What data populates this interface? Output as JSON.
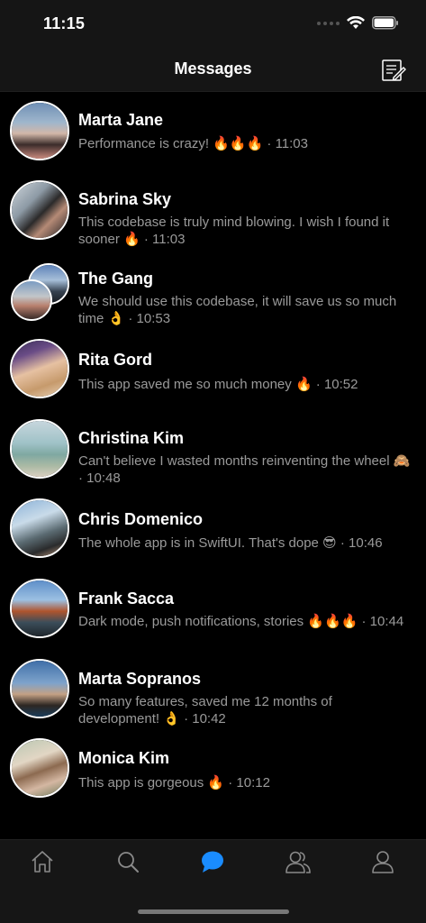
{
  "status": {
    "time": "11:15"
  },
  "nav": {
    "title": "Messages",
    "compose_icon": "compose-icon"
  },
  "conversations": [
    {
      "name": "Marta Jane",
      "message": "Performance is crazy! 🔥🔥🔥 · 11:03"
    },
    {
      "name": "Sabrina Sky",
      "message": "This codebase is truly mind blowing.  I wish I found it sooner 🔥 · 11:03"
    },
    {
      "name": "The Gang",
      "message": "We should use this codebase, it will save us so much time 👌 · 10:53"
    },
    {
      "name": "Rita Gord",
      "message": "This app saved me so much money 🔥 · 10:52"
    },
    {
      "name": "Christina Kim",
      "message": "Can't believe I wasted months reinventing the wheel 🙈 · 10:48"
    },
    {
      "name": "Chris Domenico",
      "message": "The whole app is in SwiftUI. That's dope 😎 · 10:46"
    },
    {
      "name": "Frank Sacca",
      "message": "Dark mode, push notifications, stories 🔥🔥🔥 · 10:44"
    },
    {
      "name": "Marta Sopranos",
      "message": "So many features, saved me 12 months of development! 👌 · 10:42"
    },
    {
      "name": "Monica Kim",
      "message": "This app is gorgeous 🔥 · 10:12"
    }
  ],
  "tabs": [
    {
      "icon": "home-icon",
      "active": false
    },
    {
      "icon": "search-icon",
      "active": false
    },
    {
      "icon": "chat-bubble-icon",
      "active": true
    },
    {
      "icon": "friends-icon",
      "active": false
    },
    {
      "icon": "profile-icon",
      "active": false
    }
  ],
  "colors": {
    "accent": "#1a8cff",
    "inactive": "#8a8a8a",
    "background": "#000000",
    "bar": "#151515"
  }
}
